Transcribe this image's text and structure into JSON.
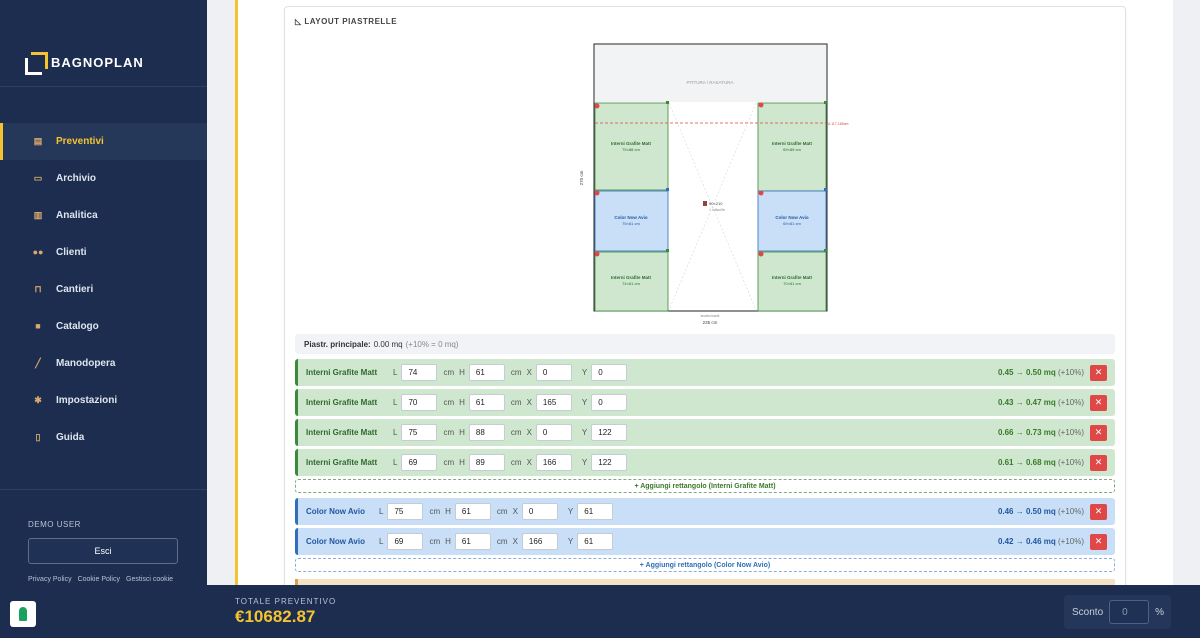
{
  "brand": {
    "name": "BAGNOPLAN"
  },
  "nav": [
    {
      "label": "Preventivi",
      "icon": "clipboard-icon",
      "active": true
    },
    {
      "label": "Archivio",
      "icon": "folder-icon"
    },
    {
      "label": "Analitica",
      "icon": "bar-chart-icon"
    },
    {
      "label": "Clienti",
      "icon": "users-icon"
    },
    {
      "label": "Cantieri",
      "icon": "construction-icon"
    },
    {
      "label": "Catalogo",
      "icon": "box-icon"
    },
    {
      "label": "Manodopera",
      "icon": "wrench-icon"
    },
    {
      "label": "Impostazioni",
      "icon": "gear-icon"
    },
    {
      "label": "Guida",
      "icon": "book-icon"
    }
  ],
  "user": {
    "name": "DEMO USER",
    "logout": "Esci"
  },
  "legal": [
    "Privacy Policy",
    "Cookie Policy",
    "Gestisci cookie"
  ],
  "layout": {
    "title": "LAYOUT PIASTRELLE",
    "band": "PITTURA / RASATURA",
    "height_label": "270 cm",
    "width_label": "235 cm",
    "width_small": "lavabo/sanit",
    "door_label": "90×210",
    "door_sub": "+ infissi/fa",
    "marker_label": "A 117-165cm",
    "tiles": [
      {
        "name": "Interni Grafite Matt",
        "size": "75×88 cm",
        "color": "green"
      },
      {
        "name": "Interni Grafite Matt",
        "size": "69×89 cm",
        "color": "green"
      },
      {
        "name": "Color Now Avio",
        "size": "75×61 cm",
        "color": "blue"
      },
      {
        "name": "Color Now Avio",
        "size": "69×61 cm",
        "color": "blue"
      },
      {
        "name": "Interni Grafite Matt",
        "size": "74×61 cm",
        "color": "green"
      },
      {
        "name": "Interni Grafite Matt",
        "size": "70×61 cm",
        "color": "green"
      }
    ]
  },
  "summary": {
    "label": "Piastr. principale:",
    "value": "0.00 mq",
    "extra": "(+10% = 0 mq)"
  },
  "labels": {
    "L": "L",
    "H": "H",
    "cm": "cm",
    "X": "X",
    "Y": "Y",
    "pct": "(+10%)",
    "del": "✕"
  },
  "green_rows": [
    {
      "name": "Interni Grafite Matt",
      "L": "74",
      "H": "61",
      "X": "0",
      "Y": "0",
      "area": "0.45 → 0.50 mq"
    },
    {
      "name": "Interni Grafite Matt",
      "L": "70",
      "H": "61",
      "X": "165",
      "Y": "0",
      "area": "0.43 → 0.47 mq"
    },
    {
      "name": "Interni Grafite Matt",
      "L": "75",
      "H": "88",
      "X": "0",
      "Y": "122",
      "area": "0.66 → 0.73 mq"
    },
    {
      "name": "Interni Grafite Matt",
      "L": "69",
      "H": "89",
      "X": "166",
      "Y": "122",
      "area": "0.61 → 0.68 mq"
    }
  ],
  "add_green": "+ Aggiungi rettangolo (Interni Grafite Matt)",
  "blue_rows": [
    {
      "name": "Color Now Avio",
      "L": "75",
      "H": "61",
      "X": "0",
      "Y": "61",
      "area": "0.46 → 0.50 mq"
    },
    {
      "name": "Color Now Avio",
      "L": "69",
      "H": "61",
      "X": "166",
      "Y": "61",
      "area": "0.42 → 0.46 mq"
    }
  ],
  "add_blue": "+ Aggiungi rettangolo (Color Now Avio)",
  "footer": {
    "total_label": "TOTALE PREVENTIVO",
    "total": "€10682.87",
    "discount_label": "Sconto",
    "discount_value": "0",
    "percent": "%"
  },
  "colors": {
    "navy": "#1c2d4f",
    "accent": "#f4c430",
    "green": "#cfe7cf",
    "blue": "#c8dff7",
    "danger": "#e04848"
  }
}
